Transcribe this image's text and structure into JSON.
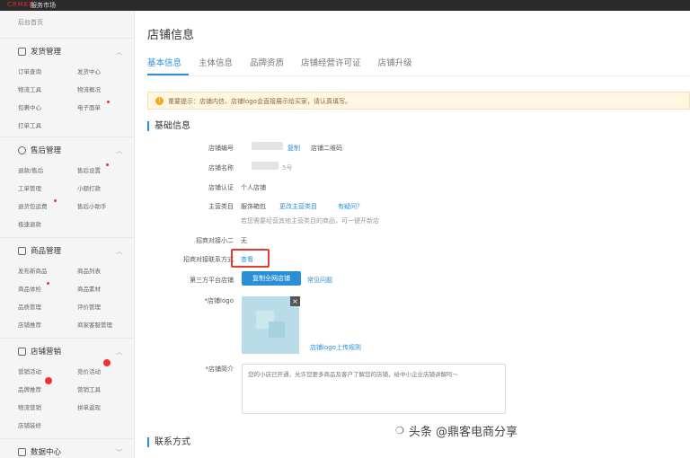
{
  "topbar": {
    "logo": "CRMEB",
    "brand": "服务市场"
  },
  "sidebar": {
    "home": "后台首页",
    "groups": [
      {
        "title": "发货管理",
        "items": [
          "订单查询",
          "发货中心",
          "物流工具",
          "物流概况",
          "包裹中心",
          "电子面单",
          "打单工具"
        ]
      },
      {
        "title": "售后管理",
        "items": [
          "退款/售后",
          "售后设置",
          "工单管理",
          "小额打款",
          "退货包运费",
          "售后小助手",
          "极速退款"
        ]
      },
      {
        "title": "商品管理",
        "items": [
          "发布新商品",
          "商品列表",
          "商品体检",
          "商品素材",
          "品质管理",
          "评价管理",
          "店铺推荐",
          "商家客服管理"
        ]
      },
      {
        "title": "店铺营销",
        "items": [
          "营销活动",
          "竞价活动",
          "品牌推荐",
          "营销工具",
          "物流营销",
          "拼单返现",
          "店铺装修"
        ]
      },
      {
        "title": "数据中心",
        "items": []
      }
    ]
  },
  "main": {
    "title": "店铺信息",
    "tabs": [
      "基本信息",
      "主体信息",
      "品牌资质",
      "店铺经营许可证",
      "店铺升级"
    ],
    "notice": "重要提示：店铺内信、店铺logo会直接展示给买家，请认真填写。",
    "notice_icon": "!",
    "section_basic": "基础信息",
    "fields": {
      "shop_id_label": "店铺编号",
      "copy_link": "复制",
      "qr_link": "店铺二维码",
      "shop_name_label": "店铺名称",
      "shop_name_suffix": "5号",
      "cert_label": "店铺认证",
      "cert_value": "个人店铺",
      "category_label": "主营类目",
      "category_value": "服饰箱包",
      "change_category": "更改主营类目",
      "question": "有疑问？",
      "category_hint": "若您需要经营其他主营类目的商品，可一键开新店",
      "open_new": "一键开新店",
      "xiaoer_label": "招商对接小二",
      "xiaoer_value": "无",
      "contact_label": "招商对接联系方式",
      "contact_link": "查看",
      "third_label": "第三方平台店铺",
      "third_button": "复制全网店铺",
      "faq": "常见问题",
      "logo_label": "*店铺logo",
      "logo_close": "×",
      "logo_rule": "店铺logo上传规则",
      "intro_label": "*店铺简介",
      "intro_placeholder": "您的小店已开通，允许您更多商品及客户了解您的店铺，给中小企业店铺讲解吗～"
    },
    "section_contact": "联系方式"
  },
  "watermark": {
    "text": "头条 @鼎客电商分享",
    "icon": "chat-icon"
  }
}
